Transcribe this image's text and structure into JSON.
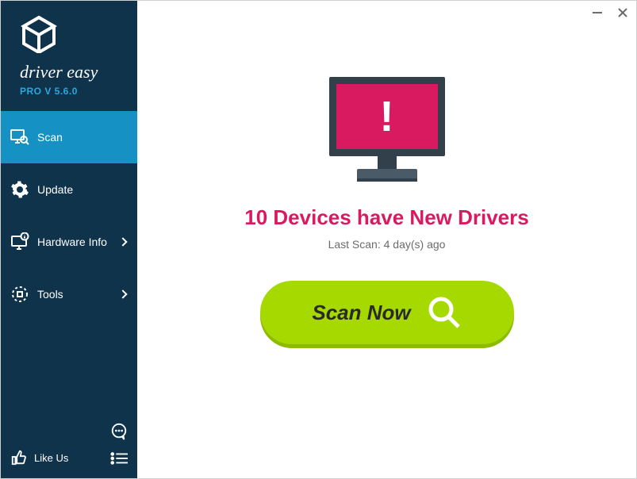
{
  "brand": {
    "name": "driver easy",
    "version_label": "PRO V 5.6.0"
  },
  "sidebar": {
    "items": [
      {
        "label": "Scan"
      },
      {
        "label": "Update"
      },
      {
        "label": "Hardware Info"
      },
      {
        "label": "Tools"
      }
    ],
    "like_us_label": "Like Us"
  },
  "main": {
    "devices_headline": "10 Devices have New Drivers",
    "last_scan_text": "Last Scan: 4 day(s) ago",
    "scan_button_label": "Scan Now"
  },
  "accent_colors": {
    "sidebar_bg": "#10334c",
    "sidebar_active": "#1691c3",
    "alert_pink": "#da1a60",
    "scan_green": "#a5d900"
  }
}
